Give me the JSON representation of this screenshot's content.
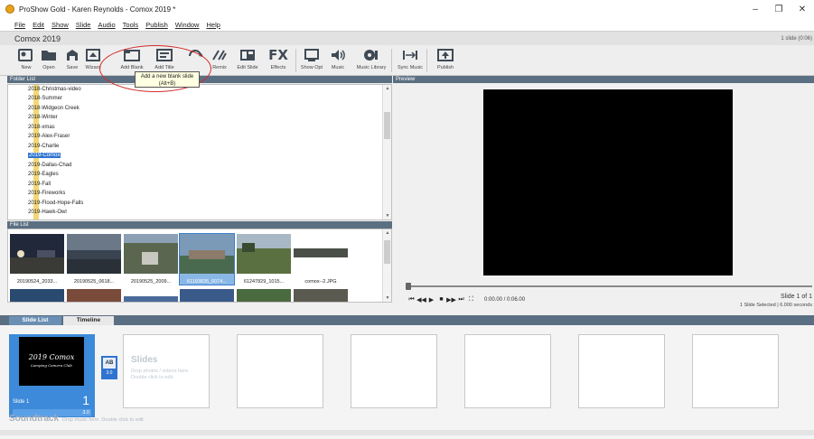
{
  "window": {
    "title": "ProShow Gold - Karen Reynolds - Comox 2019 *",
    "minimize": "–",
    "maximize": "❐",
    "close": "✕"
  },
  "menu": [
    "File",
    "Edit",
    "Show",
    "Slide",
    "Audio",
    "Tools",
    "Publish",
    "Window",
    "Help"
  ],
  "project": {
    "name": "Comox 2019",
    "slide_count": "1 slide (0:06)"
  },
  "toolbar": [
    {
      "label": "New",
      "icon": "new-show-icon"
    },
    {
      "label": "Open",
      "icon": "open-folder-icon"
    },
    {
      "label": "Save",
      "icon": "save-icon"
    },
    {
      "label": "Wizard",
      "icon": "wizard-icon"
    },
    {
      "label": "Add Blank",
      "icon": "add-blank-slide-icon"
    },
    {
      "label": "Add Title",
      "icon": "add-title-slide-icon"
    },
    {
      "label": "Remix",
      "icon": "remix-icon"
    },
    {
      "label": "Edit Slide",
      "icon": "edit-slide-icon"
    },
    {
      "label": "Effects",
      "icon": "effects-icon"
    },
    {
      "label": "Show Opt",
      "icon": "show-options-icon"
    },
    {
      "label": "Music",
      "icon": "music-icon"
    },
    {
      "label": "Music Library",
      "icon": "music-library-icon"
    },
    {
      "label": "Sync Music",
      "icon": "sync-music-icon"
    },
    {
      "label": "Publish",
      "icon": "publish-icon"
    }
  ],
  "effects_glyph": "FX",
  "tooltip": {
    "line1": "Add a new blank slide",
    "line2": "(Alt+B)"
  },
  "folder_panel": {
    "header": "Folder List",
    "items": [
      "2018-Christmas-video",
      "2018-Summer",
      "2018-Widgeon Creek",
      "2018-Winter",
      "2018-xmas",
      "2019-Alex-Fraser",
      "2019-Charlie",
      "2019-Comox",
      "2019-Dallas-Chad",
      "2019-Eagles",
      "2019-Fall",
      "2019-Fireworks",
      "2019-Flood-Hope-Falls",
      "2019-Hawk-Owl"
    ],
    "selected": "2019-Comox"
  },
  "file_panel": {
    "header": "File List",
    "files": [
      "20190524_2033...",
      "20190525_0618...",
      "20190525_2009...",
      "61193835_6074...",
      "61247829_1015...",
      "comox--2.JPG"
    ],
    "selected": "61193835_6074..."
  },
  "preview_panel": {
    "header": "Preview",
    "time": "0:00.00 / 0:06.00",
    "slide_of": "Slide 1 of 1",
    "selection_info": "1 Slide Selected  |  6.000 seconds"
  },
  "tabs": {
    "slide_list": "Slide List",
    "timeline": "Timeline"
  },
  "slide": {
    "title_line1": "2019 Comox",
    "title_line2": "Lamping Camera Club",
    "name": "Slide 1",
    "number": "1",
    "duration": "3.0",
    "transition_glyph": "AB",
    "transition_duration": "3.0"
  },
  "empty_slot": {
    "title": "Slides",
    "hint_line1": "Drop photos / videos here.",
    "hint_line2": "Double click to edit."
  },
  "soundtrack": {
    "title": "Soundtrack",
    "hint": "Drop music here.  Double click to edit."
  },
  "colors": {
    "panel_header": "#5b6f82",
    "selection_blue": "#2f74d0",
    "annotation_red": "#d22a2a"
  }
}
